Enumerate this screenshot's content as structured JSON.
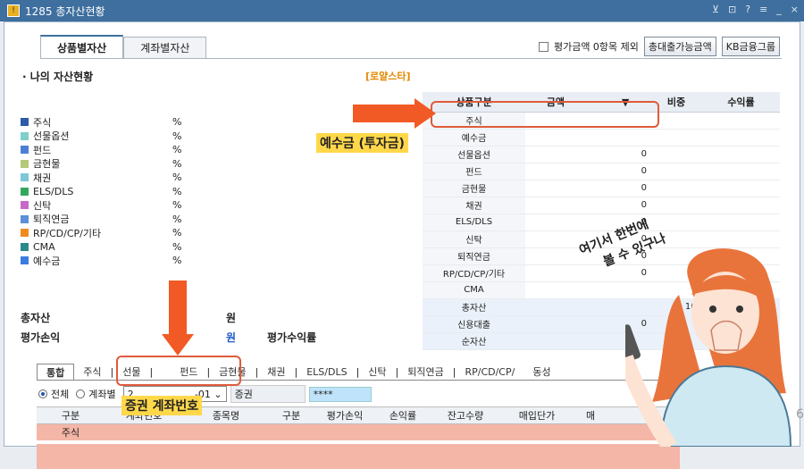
{
  "window": {
    "title": "1285 총자산현황",
    "controls": [
      "⊻",
      "⊡",
      "?",
      "≡",
      "_",
      "×"
    ]
  },
  "tabs": [
    {
      "label": "상품별자산",
      "active": true
    },
    {
      "label": "계좌별자산",
      "active": false
    }
  ],
  "topbar": {
    "exclude_label": "평가금액 0항목 제외",
    "btn_total": "총대출가능금액",
    "btn_group": "KB금융그룹"
  },
  "left": {
    "title": "· 나의 자산현황",
    "loyal": "[로얄스타]",
    "legend": [
      {
        "label": "주식",
        "color": "#2f5aa8",
        "pct": "%"
      },
      {
        "label": "선물옵션",
        "color": "#7fcfcb",
        "pct": "%"
      },
      {
        "label": "펀드",
        "color": "#4b7fd6",
        "pct": "%"
      },
      {
        "label": "금현물",
        "color": "#b4c978",
        "pct": "%"
      },
      {
        "label": "채권",
        "color": "#7ec7d8",
        "pct": "%"
      },
      {
        "label": "ELS/DLS",
        "color": "#33a85c",
        "pct": "%"
      },
      {
        "label": "신탁",
        "color": "#c66ac8",
        "pct": "%"
      },
      {
        "label": "퇴직연금",
        "color": "#5b8fd8",
        "pct": "%"
      },
      {
        "label": "RP/CD/CP/기타",
        "color": "#f08a20",
        "pct": "%"
      },
      {
        "label": "CMA",
        "color": "#2a8a8a",
        "pct": "%"
      },
      {
        "label": "예수금",
        "color": "#3c7be0",
        "pct": "%"
      }
    ],
    "total_label": "총자산",
    "total_unit": "원",
    "pl_label": "평가손익",
    "pl_unit": "원",
    "pl_rate_label": "평가수익률"
  },
  "right_table": {
    "headers": [
      "상품구분",
      "금액",
      "▼",
      "비중",
      "수익률"
    ],
    "rows": [
      {
        "name": "주식",
        "amount": ""
      },
      {
        "name": "예수금",
        "amount": ""
      },
      {
        "name": "선물옵션",
        "amount": "0"
      },
      {
        "name": "펀드",
        "amount": "0"
      },
      {
        "name": "금현물",
        "amount": "0"
      },
      {
        "name": "채권",
        "amount": "0"
      },
      {
        "name": "ELS/DLS",
        "amount": "0"
      },
      {
        "name": "신탁",
        "amount": "0"
      },
      {
        "name": "퇴직연금",
        "amount": "0"
      },
      {
        "name": "RP/CD/CP/기타",
        "amount": "0"
      },
      {
        "name": "CMA",
        "amount": ""
      },
      {
        "name": "총자산",
        "amount": "",
        "weight": "100"
      },
      {
        "name": "신용대출",
        "amount": "0"
      },
      {
        "name": "순자산",
        "amount": ""
      }
    ]
  },
  "bottom_tabs": [
    "통합",
    "주식",
    "선물",
    "",
    "펀드",
    "금현물",
    "채권",
    "ELS/DLS",
    "신탁",
    "퇴직연금",
    "RP/CD/CP/",
    "동성"
  ],
  "filter": {
    "all": "전체",
    "by_account": "계좌별",
    "account": "2",
    "account_suffix": "-01",
    "securities": "증권",
    "password": "****"
  },
  "grid": {
    "headers": [
      "구분",
      "계좌번호",
      "종목명",
      "구분",
      "평가손익",
      "손익률",
      "잔고수량",
      "매입단가",
      "매"
    ],
    "row_label": "주식"
  },
  "annotations": {
    "deposit": "예수금 (투자금)",
    "account_no": "증권 계좌번호",
    "speech_line1": "여기서 한번에",
    "speech_line2": "볼 수 있구나"
  },
  "page_number": "6"
}
